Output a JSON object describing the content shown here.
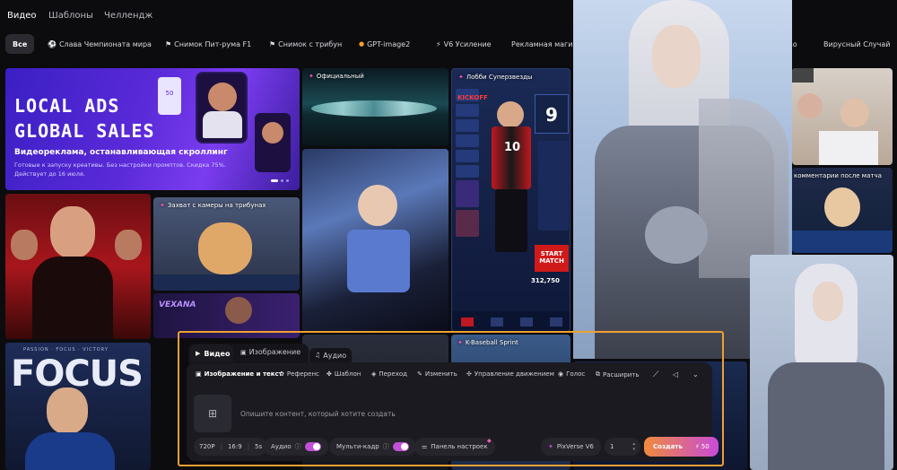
{
  "top_tabs": [
    "Видео",
    "Шаблоны",
    "Челлендж"
  ],
  "chips": [
    {
      "label": "Все",
      "icon": ""
    },
    {
      "label": "Слава Чемпионата мира",
      "icon": "⚽"
    },
    {
      "label": "Снимок Пит-рума F1",
      "icon": "⚑"
    },
    {
      "label": "Снимок с трибун",
      "icon": "⚑"
    },
    {
      "label": "GPT-image2",
      "icon": "🔔"
    },
    {
      "label": "V6 Усиление",
      "icon": "⚡"
    },
    {
      "label": "Рекламная магия",
      "icon": ""
    },
    {
      "label": "во",
      "icon": ""
    },
    {
      "label": "Вирусный Случай",
      "icon": ""
    }
  ],
  "banner": {
    "title_line1": "LOCAL ADS",
    "title_line2": "GLOBAL SALES",
    "headline": "Видеореклама, останавливающая скроллинг",
    "subtext_line1": "Готовые к запуску креативы. Без настройки промптов. Скидка 75%.",
    "subtext_line2": "Действует до 16 июля.",
    "phone_text": "50"
  },
  "tile_tags": {
    "official": "Официальный",
    "superstar": "Лобби Суперзвезды",
    "tribune": "Захват с камеры на трибунах",
    "kbaseball": "K-Baseball Sprint",
    "comments": "комментарии после матча"
  },
  "tile_texts": {
    "focus": "FOCUS",
    "focus_top": "PASSION · FOCUS · VICTORY",
    "vexana": "VEXANA",
    "game_number": "10",
    "game_rating": "9",
    "game_score": "312,750",
    "game_kickoff": "KICKOFF",
    "game_start": "START MATCH"
  },
  "composer": {
    "mode_tabs": [
      "Видео",
      "Изображение",
      "Аудио"
    ],
    "tools": [
      "Изображение и текст",
      "Референс",
      "Шаблон",
      "Переход",
      "Изменить",
      "Управление движением",
      "Голос",
      "Расширить"
    ],
    "placeholder": "Опишите контент, который хотите создать",
    "settings": {
      "resolution": "720P",
      "ratio": "16:9",
      "duration": "5s"
    },
    "audio_label": "Аудио",
    "multiframe_label": "Мульти-кадр",
    "panel_label": "Панель настроек",
    "model_label": "PixVerse V6",
    "count": "1",
    "create_label": "Создать",
    "credits": "50"
  },
  "colors": {
    "accent": "#f0a030",
    "create_gradient_start": "#f08a3c",
    "create_gradient_end": "#c84ad8",
    "toggle": "#c14fd9"
  }
}
